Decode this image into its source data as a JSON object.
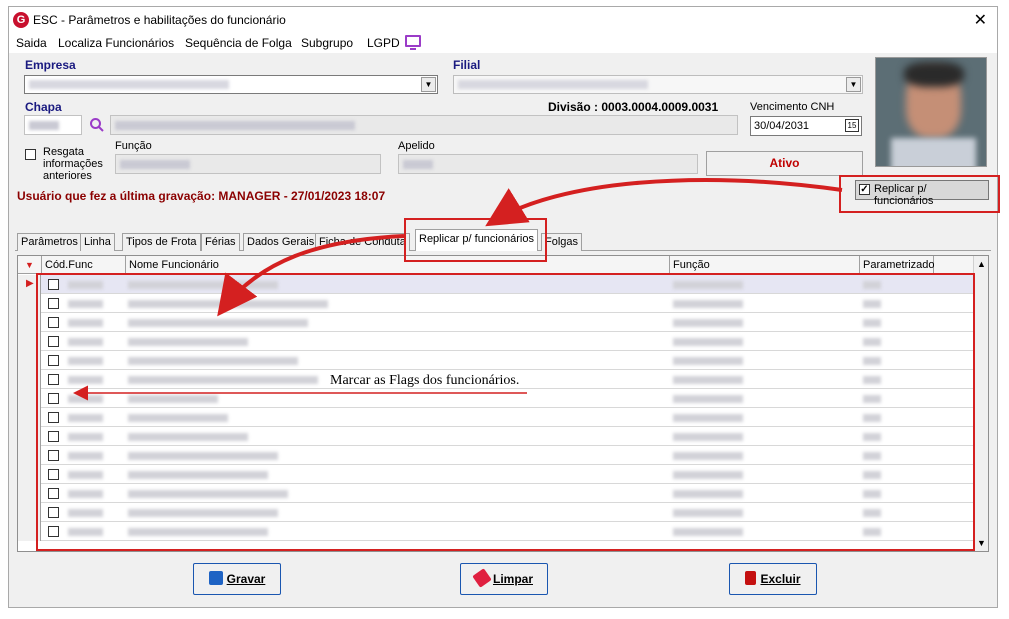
{
  "window": {
    "title": "ESC - Parâmetros e habilitações do funcionário"
  },
  "menu": [
    "Saida",
    "Localiza Funcionários",
    "Sequência de Folga",
    "Subgrupo",
    "LGPD"
  ],
  "form": {
    "empresa_label": "Empresa",
    "filial_label": "Filial",
    "chapa_label": "Chapa",
    "divisao": "Divisão : 0003.0004.0009.0031",
    "vencimento_label": "Vencimento  CNH",
    "vencimento_value": "30/04/2031",
    "resgata_label": "Resgata informações anteriores",
    "funcao_label": "Função",
    "apelido_label": "Apelido",
    "status": "Ativo",
    "replicar_checkbox_label": "Replicar p/ funcionários",
    "last_saved": "Usuário que fez a última gravação: MANAGER - 27/01/2023 18:07"
  },
  "tabs": [
    "Parâmetros",
    "Linha",
    "Tipos de Frota",
    "Férias",
    "Dados Gerais",
    "Ficha de Conduta",
    "Replicar p/ funcionários",
    "Folgas"
  ],
  "grid": {
    "columns": [
      "Cód.Func",
      "Nome Funcionário",
      "Função",
      "Parametrizado"
    ]
  },
  "annotation": "Marcar as Flags dos funcionários.",
  "buttons": {
    "save": "Gravar",
    "clear": "Limpar",
    "delete": "Excluir"
  },
  "colors": {
    "accent_red": "#d42020",
    "status_red": "#c00000",
    "title_blue": "#1a1a80"
  }
}
